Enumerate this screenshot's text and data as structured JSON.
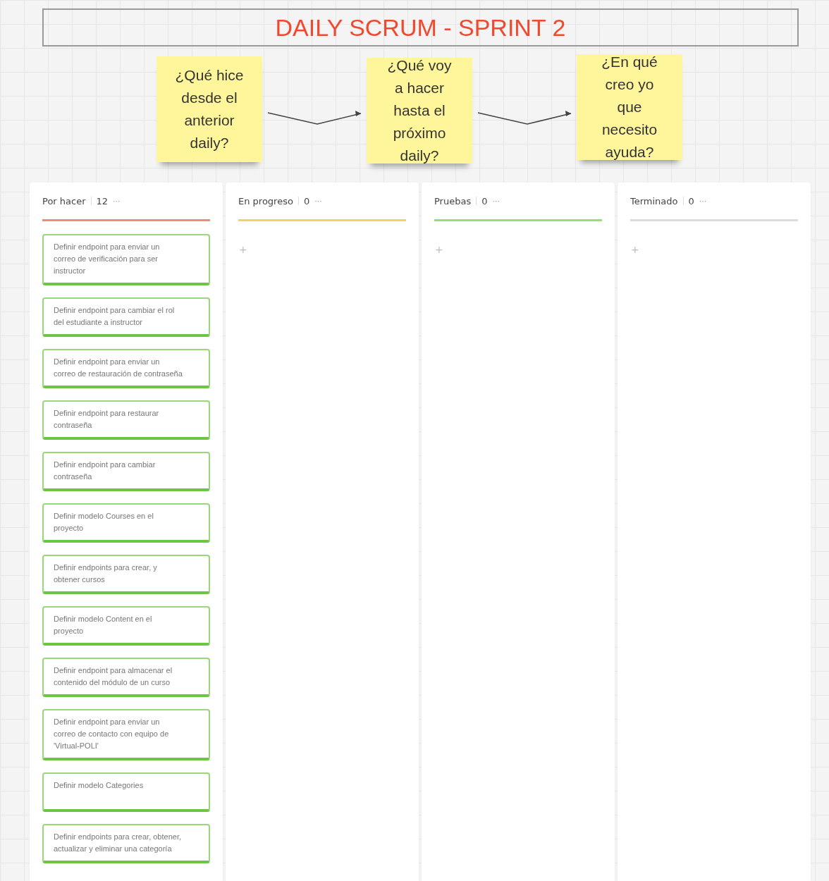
{
  "title": "DAILY SCRUM - SPRINT 2",
  "sticky_notes": [
    {
      "text": "¿Qué hice desde el anterior daily?"
    },
    {
      "text": "¿Qué voy a hacer hasta el próximo daily?"
    },
    {
      "text": "¿En qué creo yo que necesito ayuda?"
    }
  ],
  "columns": [
    {
      "title": "Por hacer",
      "count": "12",
      "menu": "···",
      "color": "#f08a7a",
      "cards": [
        {
          "text": "Definir endpoint para enviar un correo de verificación para ser instructor"
        },
        {
          "text": "Definir endpoint para cambiar el rol del estudiante a instructor"
        },
        {
          "text": "Definir endpoint para enviar un correo de restauración de contraseña"
        },
        {
          "text": "Definir endpoint para restaurar contraseña"
        },
        {
          "text": "Definir endpoint para cambiar contraseña"
        },
        {
          "text": "Definir modelo Courses en el proyecto"
        },
        {
          "text": "Definir endpoints para crear, y obtener cursos"
        },
        {
          "text": "Definir modelo Content en el proyecto"
        },
        {
          "text": "Definir endpoint para almacenar el contenido del módulo de un curso"
        },
        {
          "text": "Definir endpoint para enviar un correo de contacto con equipo de 'Virtual-POLI'"
        },
        {
          "text": "Definir modelo Categories"
        },
        {
          "text": "Definir endpoints para crear, obtener, actualizar y eliminar una categoría"
        }
      ]
    },
    {
      "title": "En progreso",
      "count": "0",
      "menu": "···",
      "color": "#f5d25a",
      "add": "+"
    },
    {
      "title": "Pruebas",
      "count": "0",
      "menu": "···",
      "color": "#9bdc7a",
      "add": "+"
    },
    {
      "title": "Terminado",
      "count": "0",
      "menu": "···",
      "color": "#dcdcdc",
      "add": "+"
    }
  ]
}
